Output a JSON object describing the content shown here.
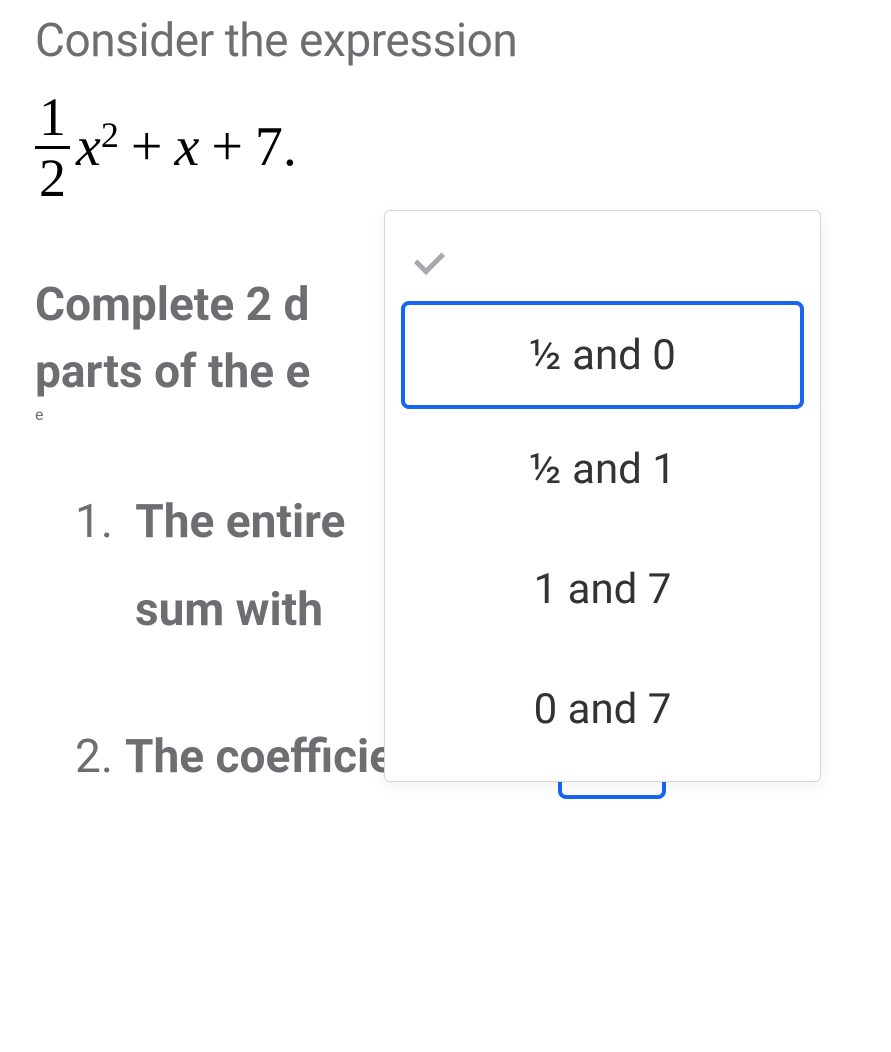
{
  "intro": "Consider the expression",
  "expression": {
    "frac_num": "1",
    "frac_den": "2",
    "var1": "x",
    "exp": "2",
    "op1": "+",
    "var2": "x",
    "op2": "+",
    "const": "7",
    "period": "."
  },
  "instruction": {
    "line1_visible": "Complete 2 d",
    "frag_right": "e",
    "line2_visible": "parts of the e"
  },
  "questions": {
    "q1": {
      "number": "1.",
      "line1_visible": "The entire",
      "line2_visible": "sum with"
    },
    "q2": {
      "number": "2.",
      "text": "The coefficients are",
      "period": "."
    }
  },
  "dropdown": {
    "options": [
      "½ and 0",
      "½ and 1",
      "1 and 7",
      "0 and 7"
    ],
    "selected_index": 0
  }
}
